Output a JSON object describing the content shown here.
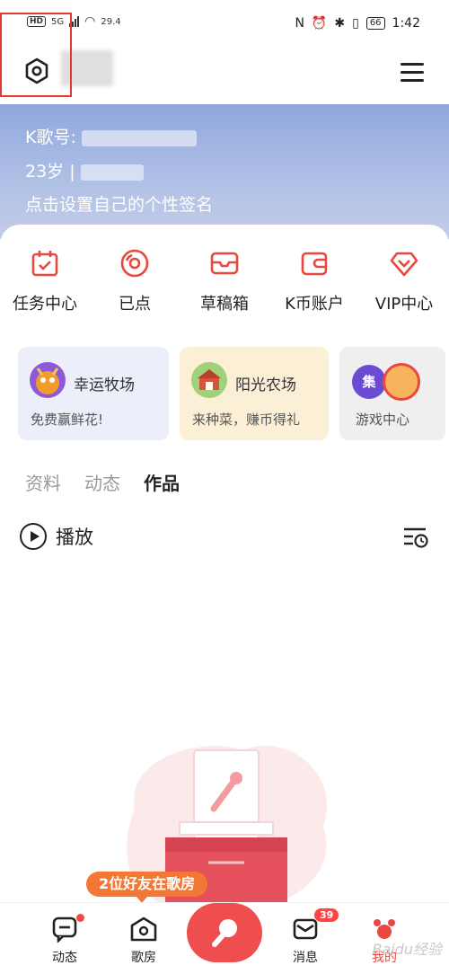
{
  "status_bar": {
    "hd": "HD",
    "network": "5G",
    "speed": "29.4",
    "battery": "66",
    "time": "1:42"
  },
  "profile": {
    "k_id_label": "K歌号:",
    "age_line": "23岁 | ",
    "signature": "点击设置自己的个性签名"
  },
  "quick_actions": [
    {
      "label": "任务中心",
      "icon": "task-calendar-icon"
    },
    {
      "label": "已点",
      "icon": "disc-icon"
    },
    {
      "label": "草稿箱",
      "icon": "inbox-tray-icon"
    },
    {
      "label": "K币账户",
      "icon": "wallet-icon"
    },
    {
      "label": "VIP中心",
      "icon": "diamond-icon"
    }
  ],
  "games": [
    {
      "title": "幸运牧场",
      "subtitle": "免费赢鲜花!"
    },
    {
      "title": "阳光农场",
      "subtitle": "来种菜，赚币得礼"
    },
    {
      "title": "",
      "subtitle": "游戏中心",
      "badge": "集"
    }
  ],
  "tabs": [
    "资料",
    "动态",
    "作品"
  ],
  "active_tab": "作品",
  "play_label": "播放",
  "friends_pill": "2位好友在歌房",
  "bottom_nav": {
    "dynamic": "动态",
    "room": "歌房",
    "messages": "消息",
    "messages_badge": "39",
    "mine": "我的"
  },
  "watermark": "Baidu经验",
  "colors": {
    "accent_red": "#e8483f",
    "header_blue": "#8fa8dc",
    "pill_orange": "#f37836"
  }
}
